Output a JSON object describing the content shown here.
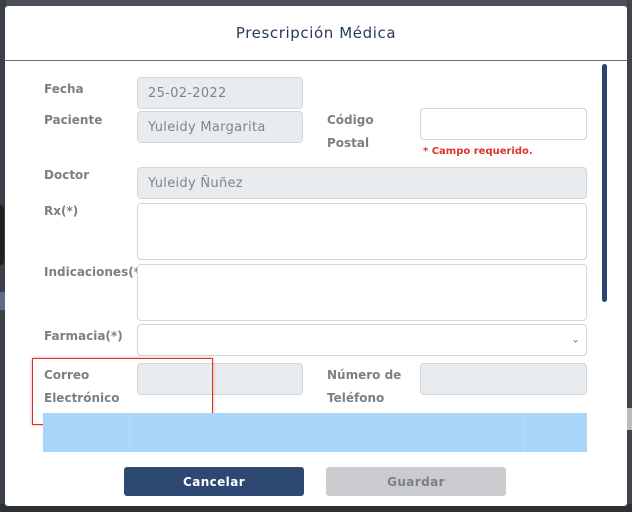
{
  "modal": {
    "title": "Prescripción Médica"
  },
  "form": {
    "fecha": {
      "label": "Fecha",
      "value": "25-02-2022"
    },
    "paciente": {
      "label": "Paciente",
      "value": "Yuleidy Margarita"
    },
    "codigo_postal": {
      "label_line1": "Código",
      "label_line2": "Postal",
      "value": "",
      "error": "* Campo requerido."
    },
    "doctor": {
      "label": "Doctor",
      "value": "Yuleidy Ñuñez"
    },
    "rx": {
      "label": "Rx(*)",
      "value": ""
    },
    "indicaciones": {
      "label": "Indicaciones(*)",
      "value": ""
    },
    "farmacia": {
      "label": "Farmacia(*)",
      "value": "",
      "icon": "chevron-down-icon"
    },
    "correo": {
      "label_line1": "Correo",
      "label_line2": "Electrónico",
      "value": ""
    },
    "telefono": {
      "label_line1": "Número de",
      "label_line2": "Teléfono",
      "value": ""
    }
  },
  "footer": {
    "cancel_label": "Cancelar",
    "save_label": "Guardar"
  },
  "colors": {
    "primary": "#2c4873",
    "error": "#d9342b",
    "table_header": "#a8d6fb"
  }
}
